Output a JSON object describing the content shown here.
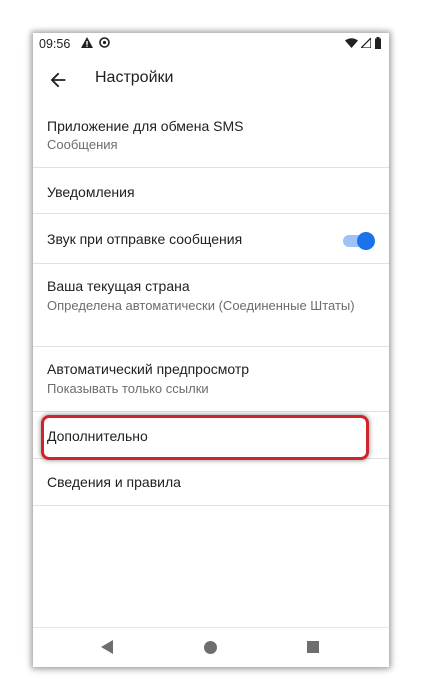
{
  "status_bar": {
    "time": "09:56"
  },
  "app_bar": {
    "title": "Настройки"
  },
  "settings": {
    "sms_app": {
      "title": "Приложение для обмена SMS",
      "subtitle": "Сообщения"
    },
    "notifications": {
      "title": "Уведомления"
    },
    "send_sound": {
      "title": "Звук при отправке сообщения",
      "enabled": true
    },
    "country": {
      "title": "Ваша текущая страна",
      "subtitle": "Определена автоматически (Соединенные Штаты)"
    },
    "preview": {
      "title": "Автоматический предпросмотр",
      "subtitle": "Показывать только ссылки"
    },
    "advanced": {
      "title": "Дополнительно"
    },
    "about": {
      "title": "Сведения и правила"
    }
  },
  "colors": {
    "accent": "#1a73e8",
    "highlight": "#d0232a"
  }
}
